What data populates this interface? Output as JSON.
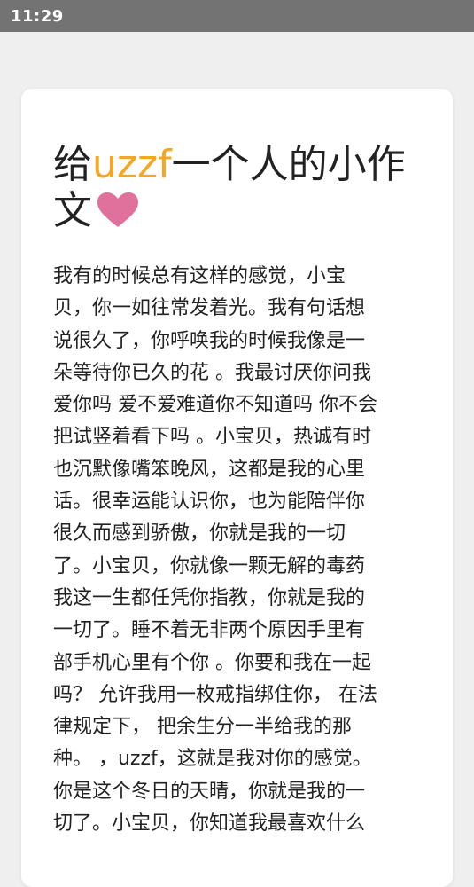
{
  "status_bar": {
    "time": "11:29"
  },
  "article": {
    "title_prefix": "给",
    "title_name": "uzzf",
    "title_suffix": "一个人的小作文",
    "heart_icon": "heart-icon",
    "heart_color": "#e0709c",
    "accent_color": "#f5a623",
    "body": "我有的时候总有这样的感觉，小宝\n贝，你一如往常发着光。我有句话想\n说很久了，你呼唤我的时候我像是一\n朵等待你已久的花 。我最讨厌你问我\n爱你吗 爱不爱难道你不知道吗 你不会\n把试竖着看下吗 。小宝贝，热诚有时\n也沉默像嘴笨晚风，这都是我的心里\n话。很幸运能认识你，也为能陪伴你\n很久而感到骄傲，你就是我的一切\n了。小宝贝，你就像一颗无解的毒药\n我这一生都任凭你指教，你就是我的\n一切了。睡不着无非两个原因手里有\n部手机心里有个你 。你要和我在一起\n吗？ 允许我用一枚戒指绑住你， 在法\n律规定下， 把余生分一半给我的那\n种。 ，uzzf，这就是我对你的感觉。\n你是这个冬日的天晴，你就是我的一\n切了。小宝贝，你知道我最喜欢什么"
  }
}
